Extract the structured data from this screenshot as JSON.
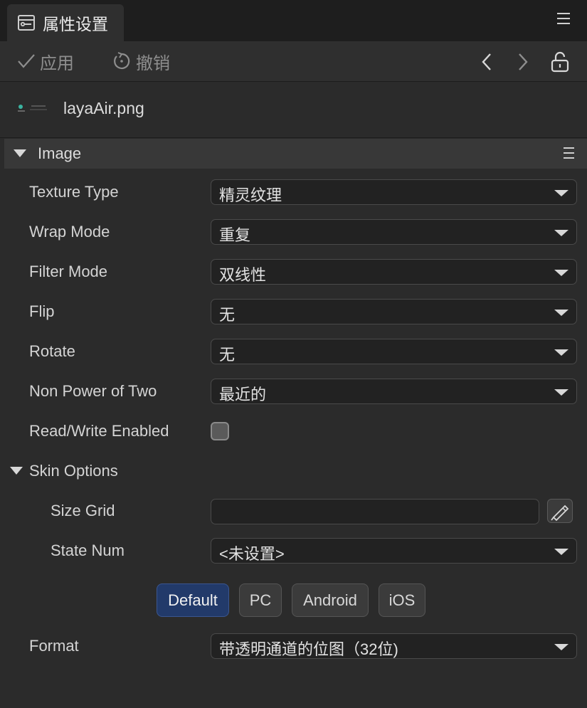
{
  "tab": {
    "title": "属性设置",
    "icon": "inspector-icon",
    "menu_icon": "hamburger-icon"
  },
  "toolbar": {
    "apply_label": "应用",
    "undo_label": "撤销",
    "icons": [
      "check-icon",
      "undo-icon",
      "chevron-left-icon",
      "chevron-right-icon",
      "lock-open-icon"
    ]
  },
  "file": {
    "name": "layaAir.png"
  },
  "section": {
    "title": "Image"
  },
  "properties": [
    {
      "label": "Texture Type",
      "value": "精灵纹理"
    },
    {
      "label": "Wrap Mode",
      "value": "重复"
    },
    {
      "label": "Filter Mode",
      "value": "双线性"
    },
    {
      "label": "Flip",
      "value": "无"
    },
    {
      "label": "Rotate",
      "value": "无"
    },
    {
      "label": "Non Power of Two",
      "value": "最近的"
    }
  ],
  "readwrite": {
    "label": "Read/Write Enabled",
    "checked": false
  },
  "skin": {
    "title": "Skin Options",
    "size_grid_label": "Size Grid",
    "size_grid_value": "",
    "state_num_label": "State Num",
    "state_num_value": "<未设置>"
  },
  "platforms": {
    "tabs": [
      "Default",
      "PC",
      "Android",
      "iOS"
    ],
    "active": "Default"
  },
  "format": {
    "label": "Format",
    "value": "带透明通道的位图（32位)"
  },
  "colors": {
    "accent": "#223a6a",
    "panel": "#2b2b2b",
    "field": "#222222"
  }
}
